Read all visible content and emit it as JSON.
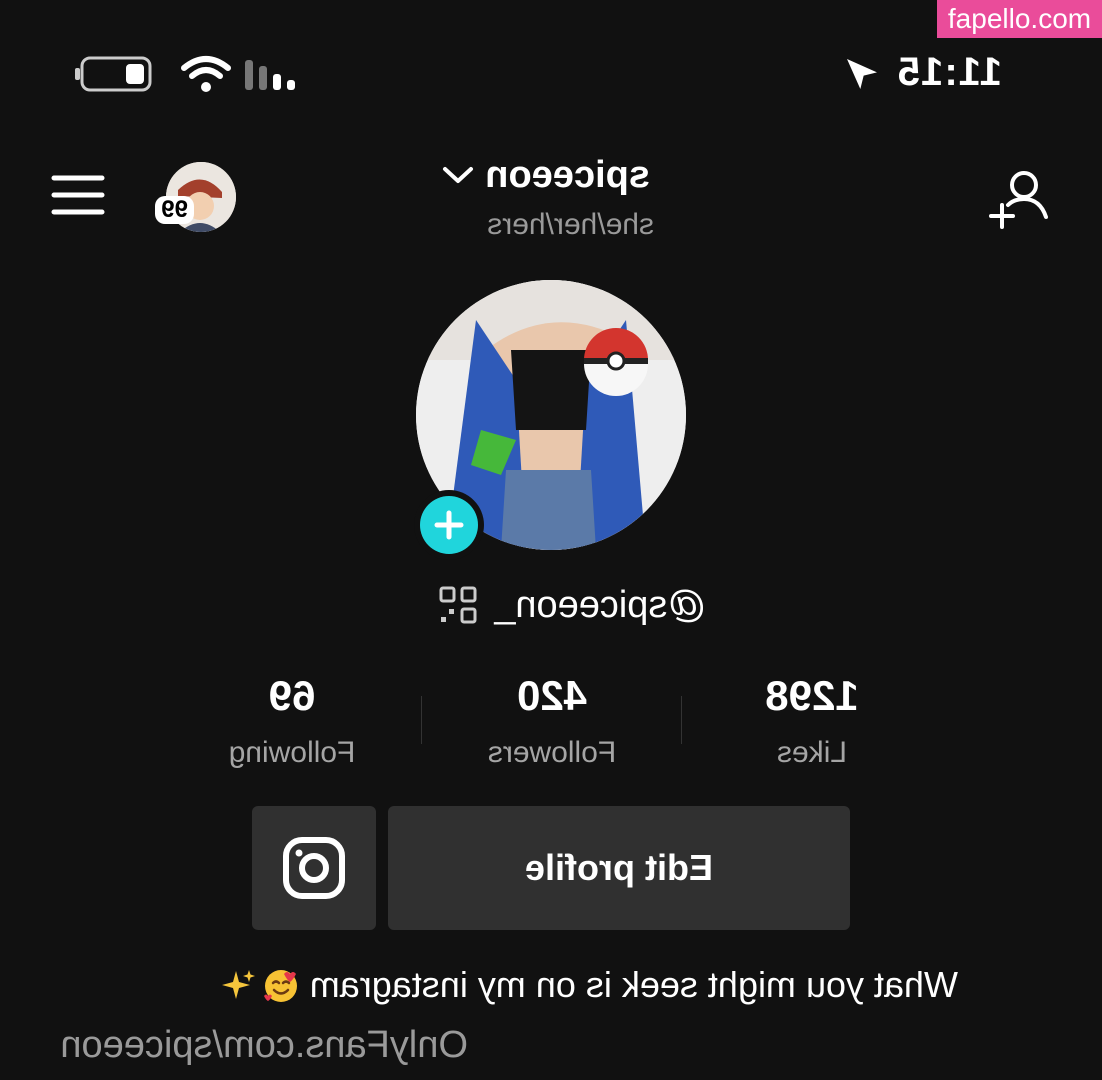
{
  "status_bar": {
    "time": "11:15"
  },
  "header": {
    "username": "spiceeon",
    "pronouns": "she/her/hers",
    "avatar_badge": "99"
  },
  "profile": {
    "handle": "@spiceeon_",
    "accent_color": "#20d5dc"
  },
  "stats": [
    {
      "value": "69",
      "label": "Following"
    },
    {
      "value": "420",
      "label": "Followers"
    },
    {
      "value": "1298",
      "label": "Likes"
    }
  ],
  "actions": {
    "edit_profile_label": "Edit profile"
  },
  "bio": {
    "text": "What you might seek is on my instagram",
    "link": "OnlyFans.com/spiceeon"
  },
  "watermark": "fapello.com",
  "icons": [
    "add-friend-icon",
    "chevron-down-icon",
    "menu-icon",
    "qr-code-icon",
    "instagram-icon",
    "plus-icon",
    "location-arrow-icon",
    "wifi-icon",
    "signal-icon",
    "battery-icon"
  ]
}
